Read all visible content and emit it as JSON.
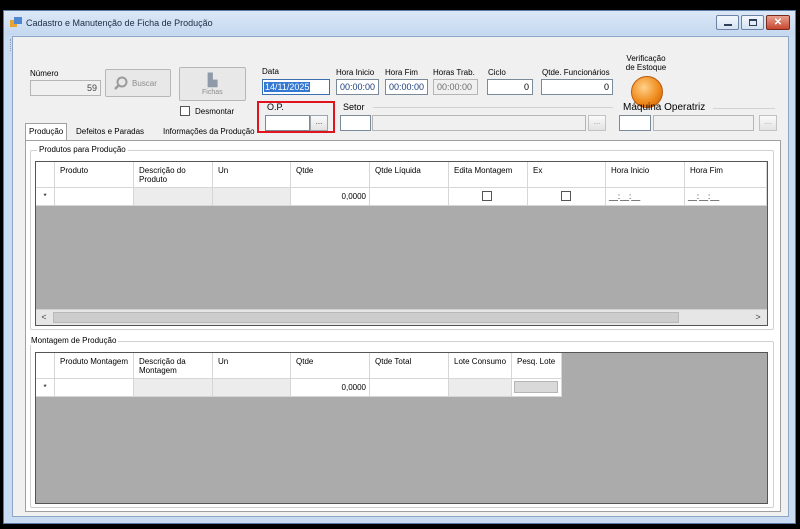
{
  "window": {
    "title": "Cadastro e Manutenção de Ficha de Produção",
    "controls": {
      "minimize": "–",
      "maximize": "□",
      "close": "✕"
    }
  },
  "toolbar": {
    "left_icons": [
      "new-doc-icon",
      "cancel-icon",
      "save-icon",
      "undo-icon",
      "copy-icon",
      "grid-icon",
      "print-icon"
    ],
    "right_icons": [
      "window-icon",
      "key-icon",
      "refresh-icon",
      "user-icon",
      "list-icon"
    ]
  },
  "header": {
    "numero_label": "Número",
    "numero_value": "59",
    "buscar_label": "Buscar",
    "fichas_label": "Fichas",
    "data_label": "Data",
    "data_value": "14/11/2025",
    "hora_inicio_label": "Hora Inicio",
    "hora_inicio_value": "00:00:00",
    "hora_fim_label": "Hora Fim",
    "hora_fim_value": "00:00:00",
    "horas_trab_label": "Horas Trab.",
    "horas_trab_value": "00:00:00",
    "ciclo_label": "Ciclo",
    "ciclo_value": "0",
    "qtde_func_label": "Qtde. Funcionários",
    "qtde_func_value": "0",
    "verif_estoque_label": "Verificação de Estoque",
    "desmontar_label": "Desmontar",
    "op_label": "O.P.",
    "op_value": "",
    "setor_label": "Setor",
    "maquina_label": "Máquina Operatriz",
    "ellipsis": "..."
  },
  "tabs": [
    {
      "label": "Produção",
      "selected": true
    },
    {
      "label": "Defeitos e Paradas",
      "selected": false
    },
    {
      "label": "Informações da Produção",
      "selected": false
    }
  ],
  "produtos": {
    "group_title": "Produtos para Produção",
    "columns": [
      "Produto",
      "Descrição do Produto",
      "Un",
      "Qtde",
      "Qtde Líquida",
      "Edita Montagem",
      "Ex",
      "Hora Inicio",
      "Hora Fim"
    ],
    "row": {
      "marker": "*",
      "qtde": "0,0000",
      "hora_inicio": "__:__:__",
      "hora_fim": "__:__:__"
    },
    "scroll_left": "<",
    "scroll_right": ">"
  },
  "montagem": {
    "group_title": "Montagem de Produção",
    "columns": [
      "Produto Montagem",
      "Descrição da Montagem",
      "Un",
      "Qtde",
      "Qtde Total",
      "Lote Consumo",
      "Pesq. Lote"
    ],
    "row": {
      "marker": "*",
      "qtde": "0,0000"
    }
  },
  "colors": {
    "highlight_border": "#e0141c",
    "selection_blue": "#3378d2",
    "orange_button": "#f08c1e"
  }
}
